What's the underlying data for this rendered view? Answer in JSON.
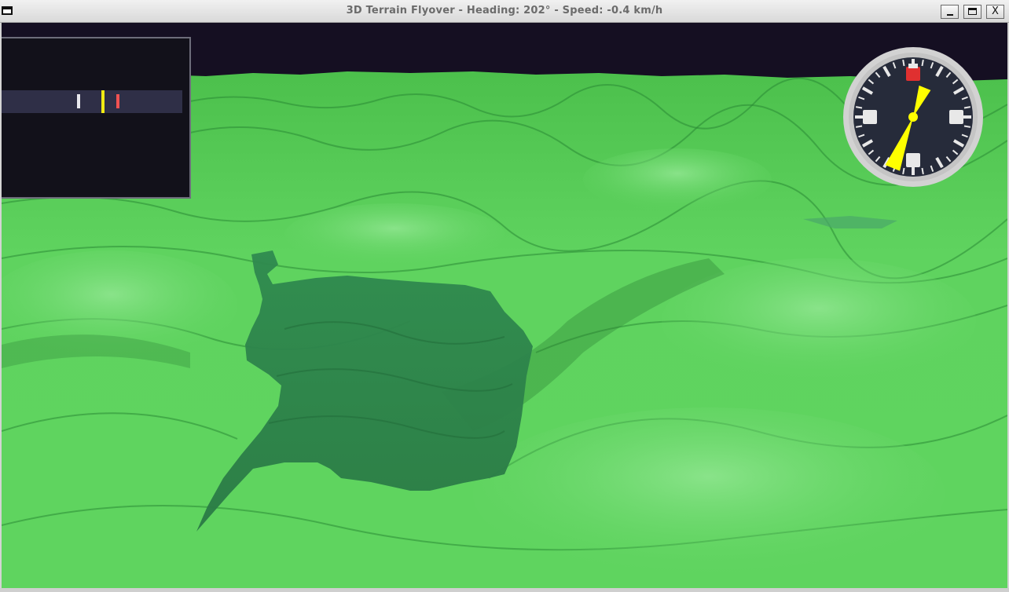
{
  "window": {
    "title": "3D Terrain Flyover - Heading: 202° - Speed: -0.4 km/h",
    "buttons": {
      "minimize": "minimize",
      "maximize": "maximize",
      "close": "X"
    }
  },
  "hud": {
    "heading_deg": 202,
    "speed_kmh": -0.4,
    "compass": {
      "dial_color": "#262b3a",
      "ring_color": "#d2d2d2",
      "pointer_color": "#ffff00",
      "north_marker_color": "#e03030"
    },
    "minimap": {
      "background": "#12111a",
      "strip_color": "#2f2f47",
      "markers": [
        {
          "name": "white-marker",
          "color": "#e8e8ee"
        },
        {
          "name": "yellow-marker",
          "color": "#f1ea13"
        },
        {
          "name": "red-marker",
          "color": "#f05252"
        }
      ]
    }
  },
  "scene": {
    "sky_color": "#150f22",
    "terrain_color": "#5fd15f",
    "water_color": "#2f7f4a"
  }
}
